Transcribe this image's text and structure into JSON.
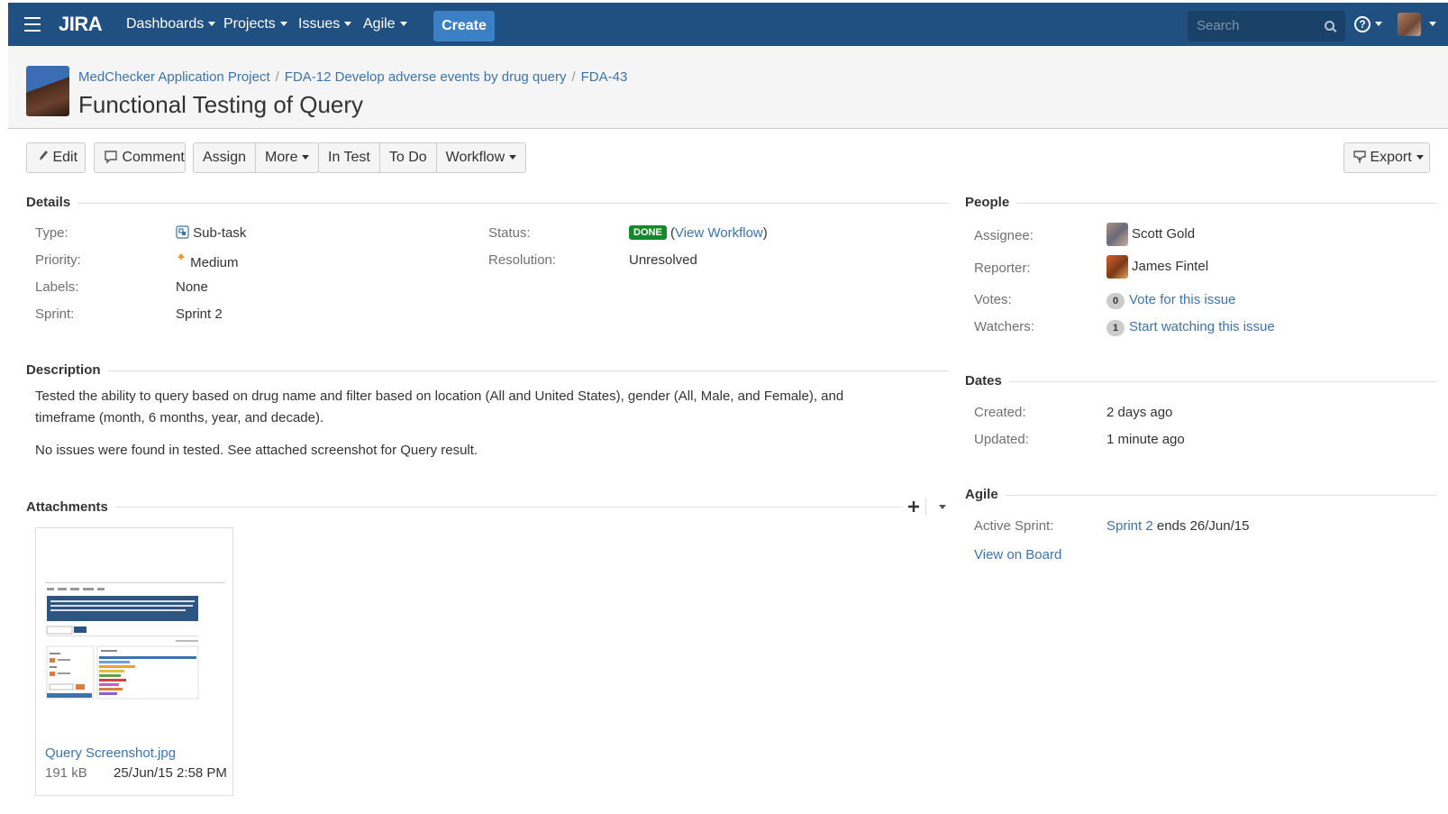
{
  "nav": {
    "logo": "JIRA",
    "menus": [
      "Dashboards",
      "Projects",
      "Issues",
      "Agile"
    ],
    "create_label": "Create",
    "search_placeholder": "Search",
    "help_label": "?"
  },
  "issue": {
    "breadcrumb": [
      "MedChecker Application Project",
      "FDA-12 Develop adverse events by drug query",
      "FDA-43"
    ],
    "title": "Functional Testing of Query"
  },
  "toolbar": {
    "edit": "Edit",
    "comment": "Comment",
    "assign": "Assign",
    "more": "More",
    "in_test": "In Test",
    "to_do": "To Do",
    "workflow": "Workflow",
    "export": "Export"
  },
  "details": {
    "heading": "Details",
    "type_label": "Type:",
    "type_value": "Sub-task",
    "priority_label": "Priority:",
    "priority_value": "Medium",
    "labels_label": "Labels:",
    "labels_value": "None",
    "sprint_label": "Sprint:",
    "sprint_value": "Sprint 2",
    "status_label": "Status:",
    "status_value": "DONE",
    "view_workflow": "View Workflow",
    "resolution_label": "Resolution:",
    "resolution_value": "Unresolved"
  },
  "description": {
    "heading": "Description",
    "para1": "Tested the ability to query based on drug name and filter based on location (All and United States), gender (All, Male, and Female), and timeframe (month, 6 months, year, and decade).",
    "para2": "No issues were found in tested. See attached screenshot for Query result."
  },
  "attachments": {
    "heading": "Attachments",
    "file_name": "Query Screenshot.jpg",
    "file_size": "191 kB",
    "file_date": "25/Jun/15 2:58 PM"
  },
  "people": {
    "heading": "People",
    "assignee_label": "Assignee:",
    "assignee_value": "Scott Gold",
    "reporter_label": "Reporter:",
    "reporter_value": "James Fintel",
    "votes_label": "Votes:",
    "votes_count": "0",
    "votes_link": "Vote for this issue",
    "watchers_label": "Watchers:",
    "watchers_count": "1",
    "watchers_link": "Start watching this issue"
  },
  "dates": {
    "heading": "Dates",
    "created_label": "Created:",
    "created_value": "2 days ago",
    "updated_label": "Updated:",
    "updated_value": "1 minute ago"
  },
  "agile": {
    "heading": "Agile",
    "active_sprint_label": "Active Sprint:",
    "sprint_link": "Sprint 2",
    "sprint_ends": "ends 26/Jun/15",
    "view_on_board": "View on Board"
  }
}
